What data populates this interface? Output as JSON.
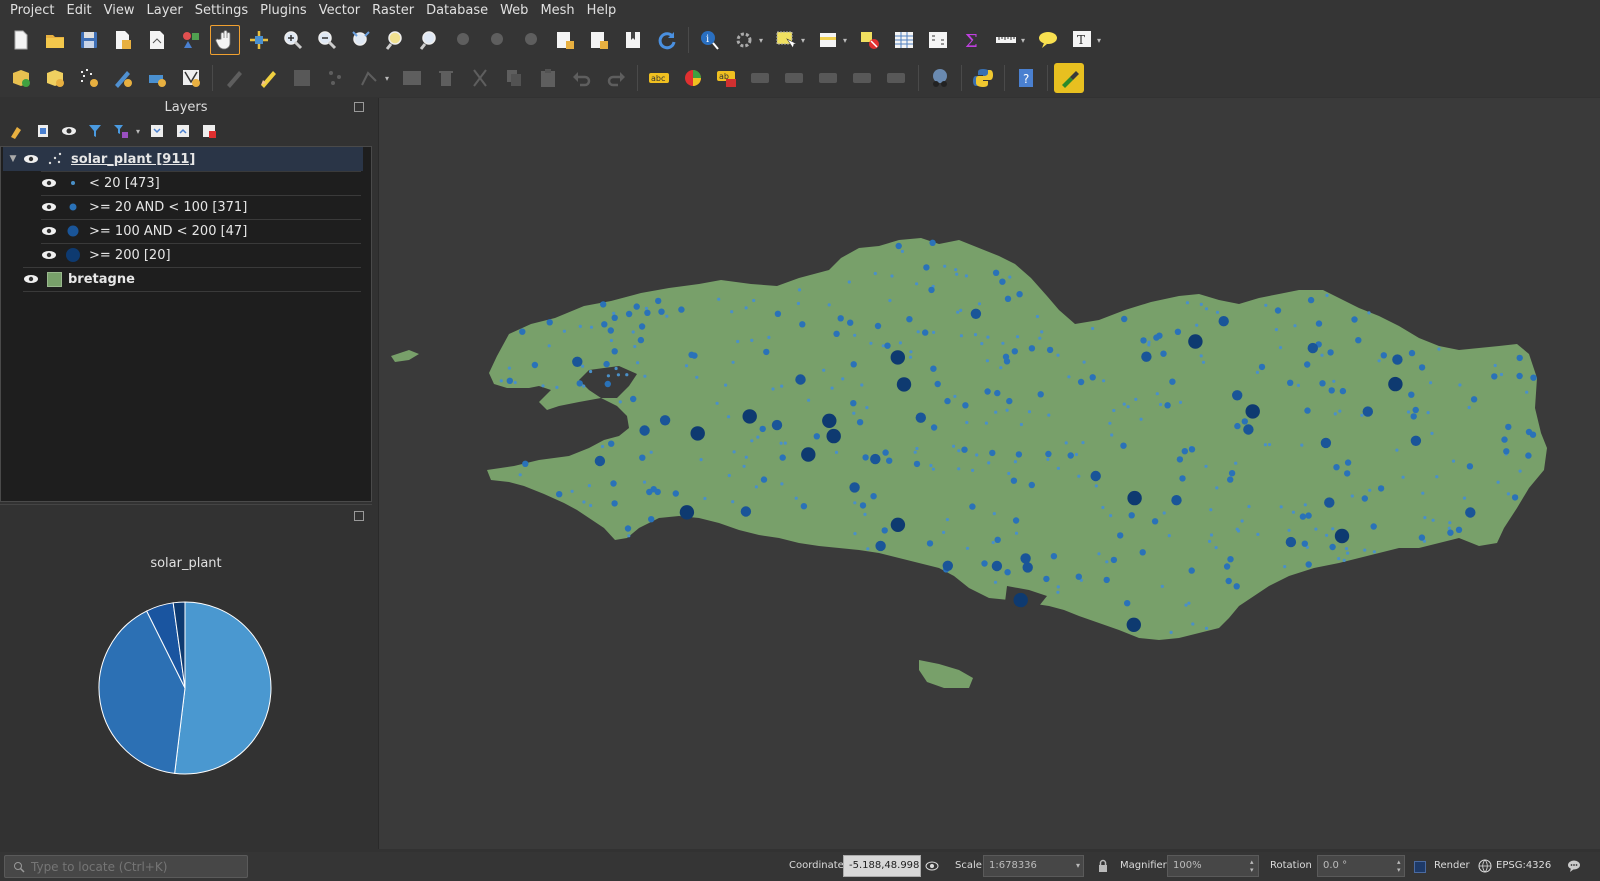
{
  "menu": [
    "Project",
    "Edit",
    "View",
    "Layer",
    "Settings",
    "Plugins",
    "Vector",
    "Raster",
    "Database",
    "Web",
    "Mesh",
    "Help"
  ],
  "layers_panel": {
    "title": "Layers",
    "layers": [
      {
        "name": "solar_plant [911]",
        "categories": [
          {
            "label": "< 20 [473]",
            "color": "#4a90c8"
          },
          {
            "label": ">= 20 AND < 100 [371]",
            "color": "#2a72b8"
          },
          {
            "label": ">= 100 AND < 200 [47]",
            "color": "#1a5598"
          },
          {
            "label": ">= 200 [20]",
            "color": "#0e3a70"
          }
        ]
      },
      {
        "name": "bretagne",
        "color": "#78a06a"
      }
    ]
  },
  "diagram_panel": {
    "title": "solar_plant",
    "pie": [
      {
        "label": "< 20",
        "value": 473,
        "color": "#4a98d0"
      },
      {
        "label": ">= 20 AND < 100",
        "value": 371,
        "color": "#2c70b4"
      },
      {
        "label": ">= 100 AND < 200",
        "value": 47,
        "color": "#1a55a0"
      },
      {
        "label": ">= 200",
        "value": 20,
        "color": "#0e3a70"
      }
    ]
  },
  "map": {
    "background": "#3a3a3a",
    "land_color": "#78a06a"
  },
  "statusbar": {
    "locator_placeholder": "Type to locate (Ctrl+K)",
    "coordinate_label": "Coordinate",
    "coordinate_value": "-5.188,48.998",
    "scale_label": "Scale",
    "scale_value": "1:678336",
    "magnifier_label": "Magnifier",
    "magnifier_value": "100%",
    "rotation_label": "Rotation",
    "rotation_value": "0.0 °",
    "render_label": "Render",
    "crs_label": "EPSG:4326"
  }
}
